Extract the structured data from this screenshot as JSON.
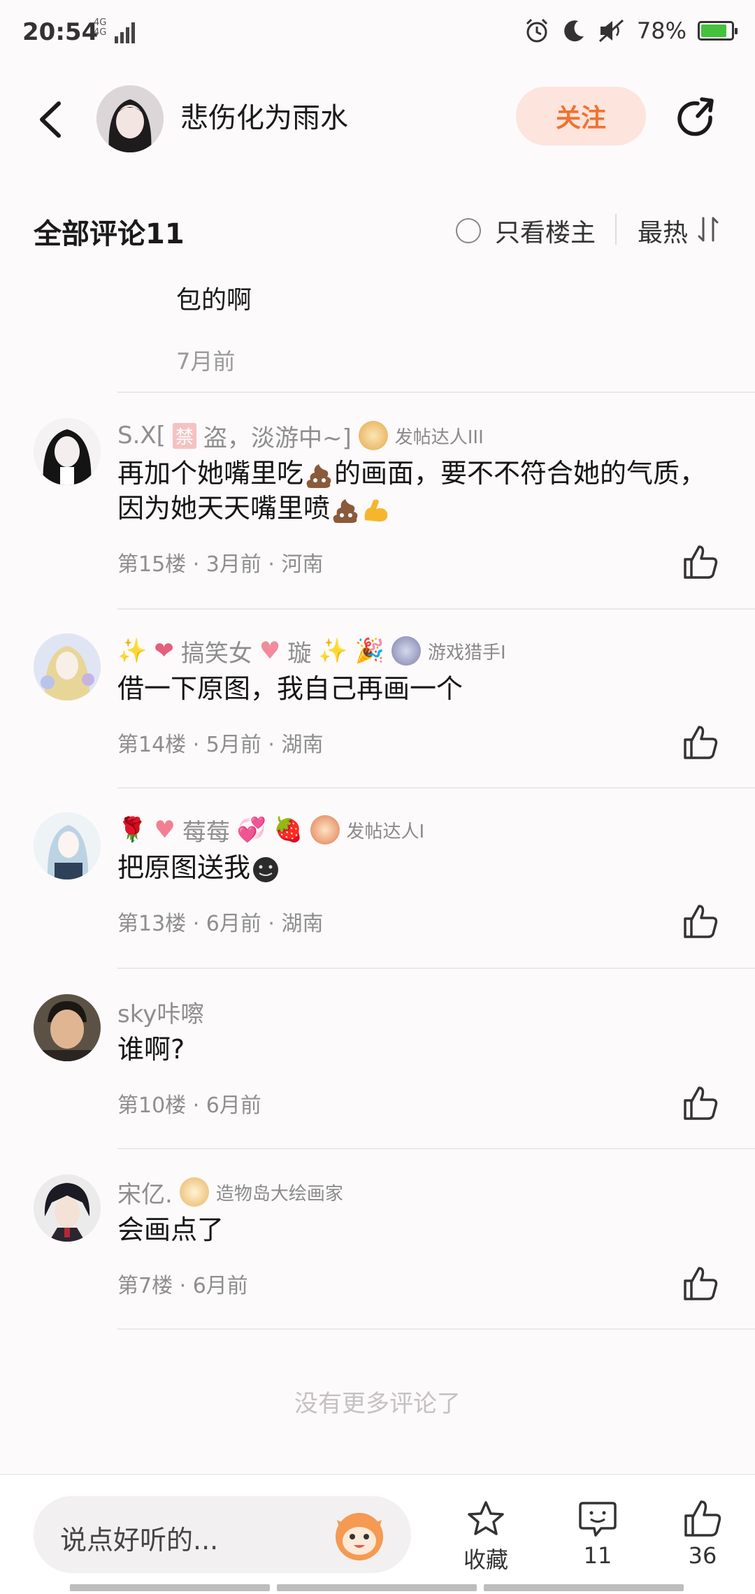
{
  "status_bar": {
    "time": "20:54",
    "network_top": "4G",
    "network_bottom": "4G",
    "battery_percent": "78%",
    "battery_level": 0.78
  },
  "header": {
    "username": "悲伤化为雨水",
    "follow_label": "关注"
  },
  "comments_section": {
    "title": "全部评论11",
    "only_op_label": "只看楼主",
    "sort_label": "最热"
  },
  "partial_reply": {
    "text": "包的啊",
    "time": "7月前"
  },
  "comments": [
    {
      "user_prefix": "S.X[",
      "user_ban": "禁",
      "user_suffix": "盗，淡游中~]",
      "badge": "发帖达人III",
      "text_parts": [
        "再加个她嘴里吃",
        "的画面，要不不符合她的气质，因为她天天嘴里喷"
      ],
      "meta": "第15楼 · 3月前 · 河南"
    },
    {
      "user": "搞笑女",
      "user_tail": "璇",
      "badge": "游戏猎手I",
      "text": "借一下原图，我自己再画一个",
      "meta": "第14楼 · 5月前 · 湖南"
    },
    {
      "user": "莓莓",
      "badge": "发帖达人I",
      "text": "把原图送我",
      "meta": "第13楼 · 6月前 · 湖南"
    },
    {
      "user": "sky咔嚓",
      "text": "谁啊?",
      "meta": "第10楼 · 6月前"
    },
    {
      "user": "宋亿.",
      "badge": "造物岛大绘画家",
      "text": "会画点了",
      "meta": "第7楼 · 6月前"
    }
  ],
  "no_more": "没有更多评论了",
  "bottom_bar": {
    "input_placeholder": "说点好听的...",
    "favorite_label": "收藏",
    "comment_count": "11",
    "like_count": "36"
  },
  "colors": {
    "accent": "#f0722f",
    "follow_bg": "#fde4dc",
    "meta_gray": "#8e8e8e"
  }
}
